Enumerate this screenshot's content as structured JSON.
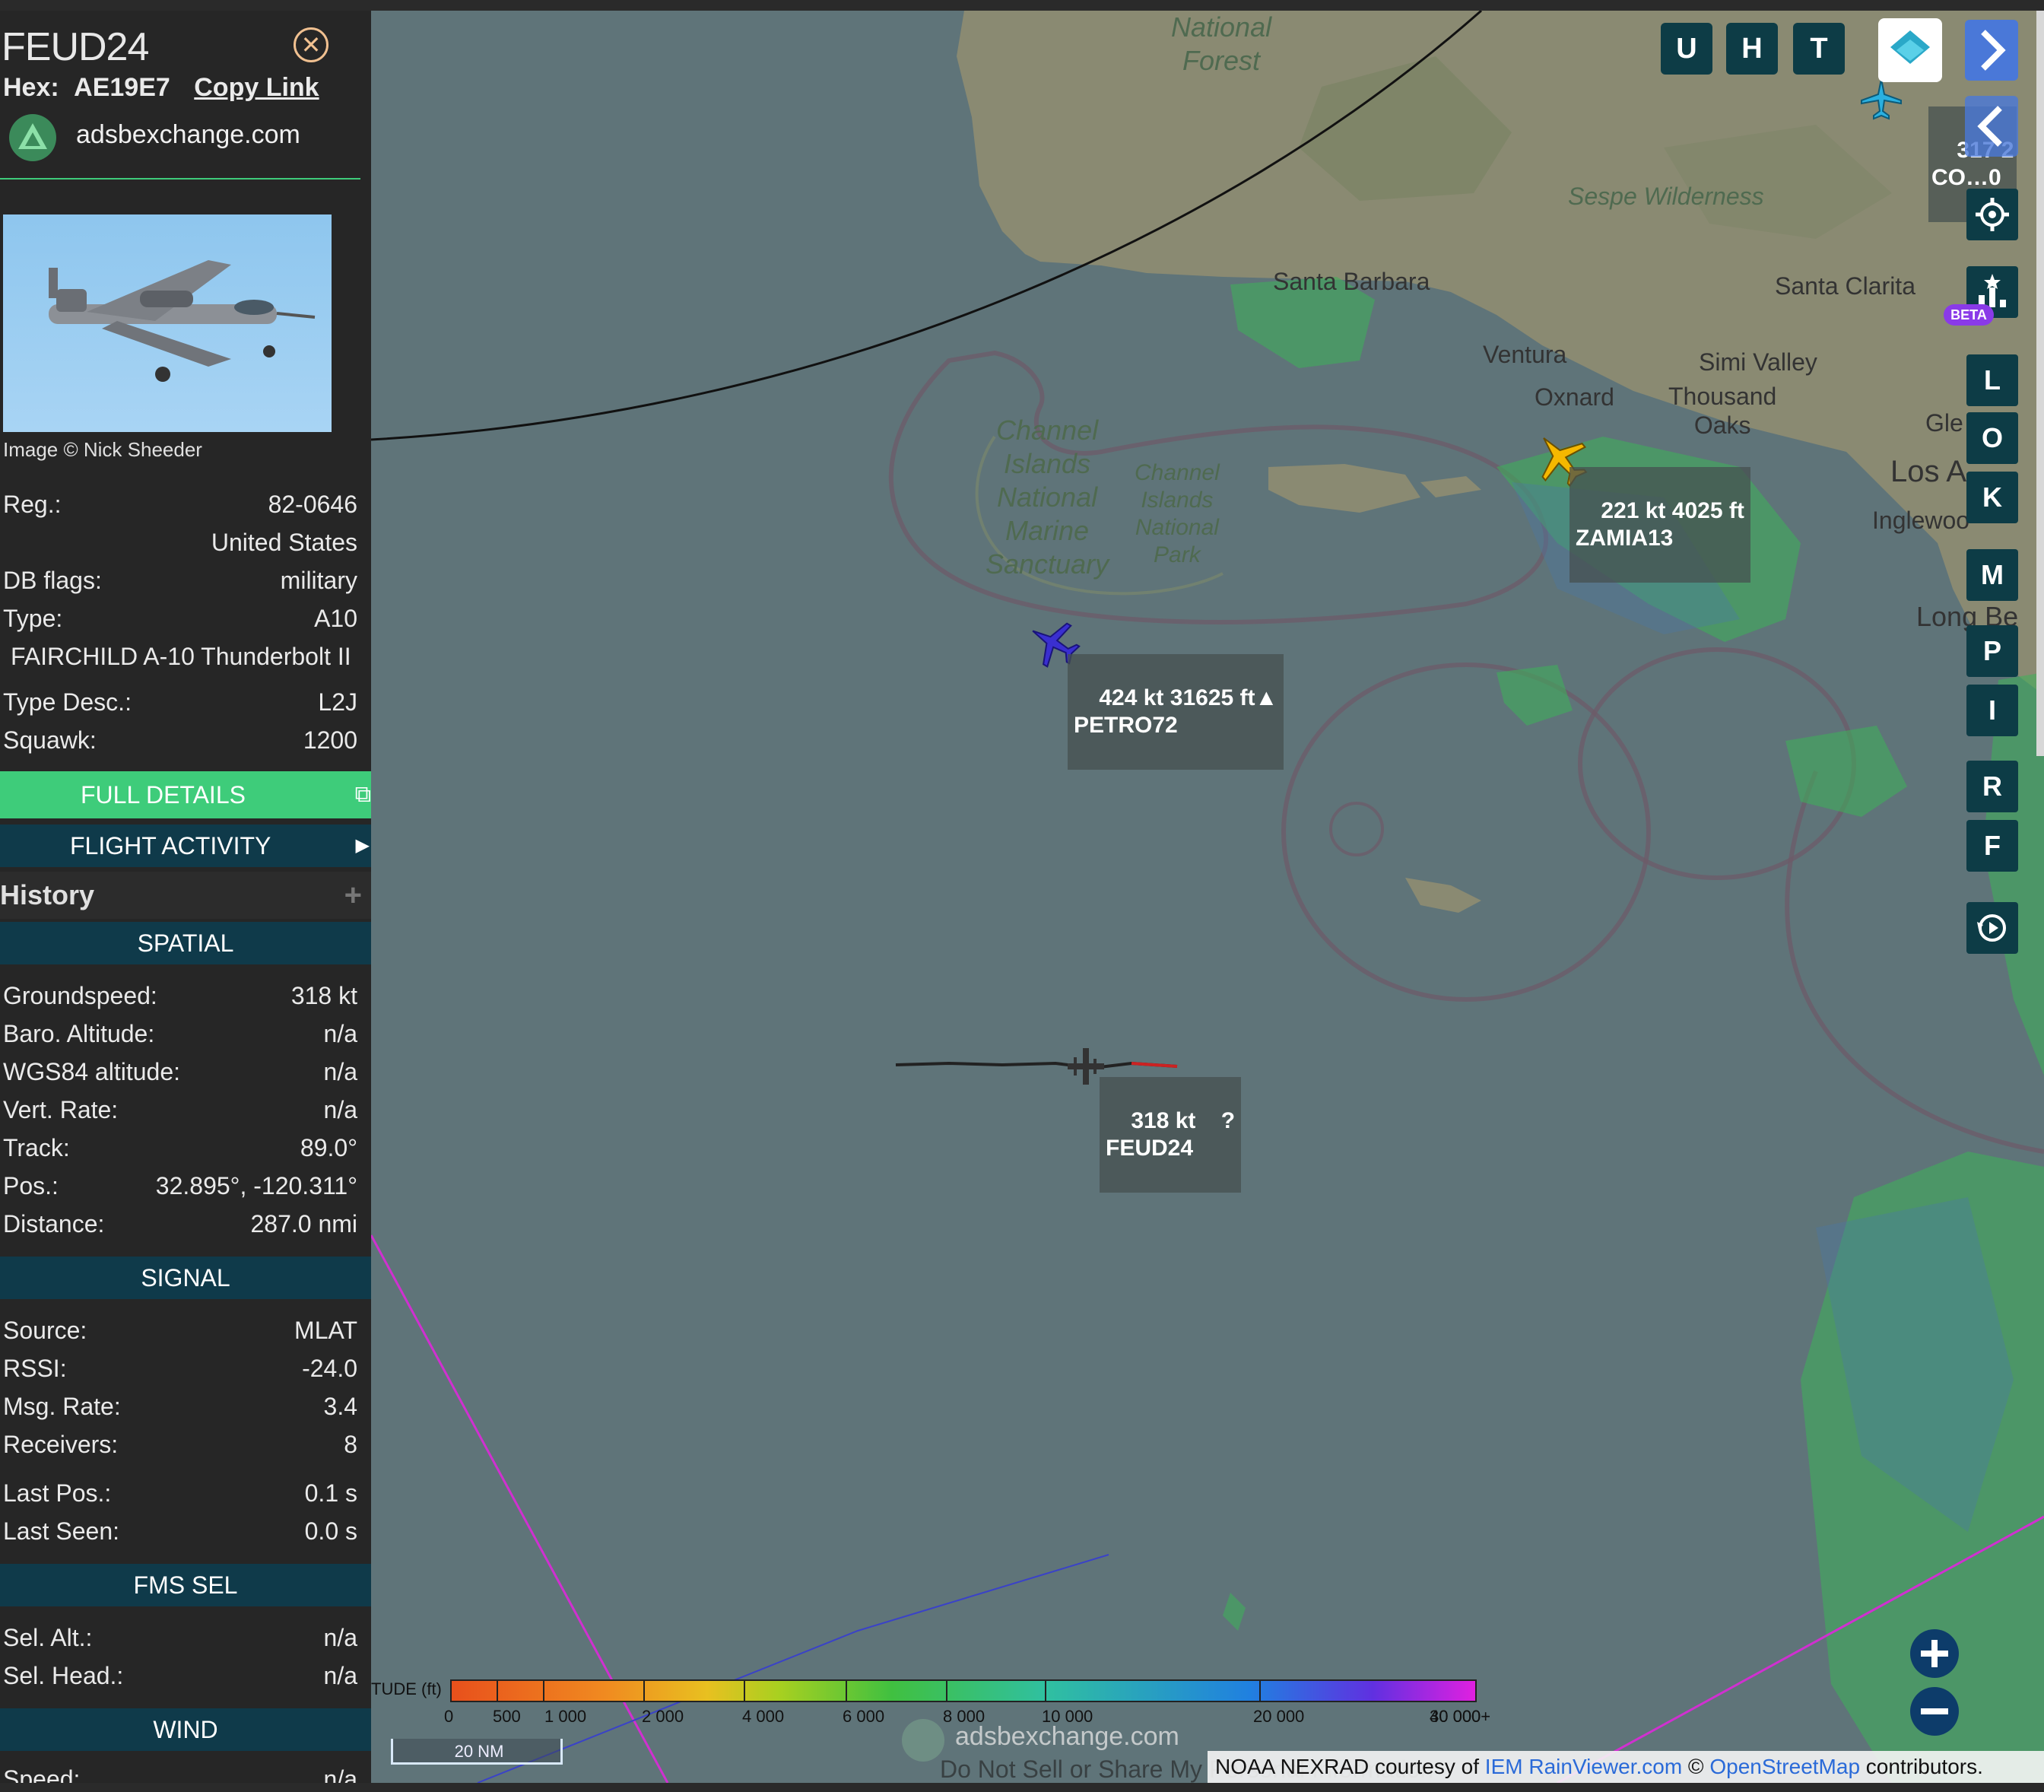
{
  "sidebar": {
    "callsign": "FEUD24",
    "hex_label": "Hex:",
    "hex_value": "AE19E7",
    "copy_link": "Copy Link",
    "site_name": "adsbexchange.com",
    "image_credit": "Image © Nick Sheeder",
    "fields_top": [
      {
        "label": "Reg.:",
        "value": "82-0646"
      },
      {
        "label": "",
        "value": "United States"
      },
      {
        "label": "DB flags:",
        "value": "military"
      },
      {
        "label": "Type:",
        "value": "A10"
      }
    ],
    "type_full": "FAIRCHILD A-10 Thunderbolt II",
    "fields_mid": [
      {
        "label": "Type Desc.:",
        "value": "L2J"
      },
      {
        "label": "Squawk:",
        "value": "1200"
      }
    ],
    "full_details": "FULL DETAILS",
    "flight_activity": "FLIGHT ACTIVITY",
    "history": "History",
    "spatial": "SPATIAL",
    "spatial_fields": [
      {
        "label": "Groundspeed:",
        "value": "318 kt"
      },
      {
        "label": "Baro. Altitude:",
        "value": "n/a"
      },
      {
        "label": "WGS84 altitude:",
        "value": "n/a"
      },
      {
        "label": "Vert. Rate:",
        "value": "n/a"
      },
      {
        "label": "Track:",
        "value": "89.0°"
      },
      {
        "label": "Pos.:",
        "value": "32.895°, -120.311°"
      },
      {
        "label": "Distance:",
        "value": "287.0 nmi"
      }
    ],
    "signal": "SIGNAL",
    "signal_fields": [
      {
        "label": "Source:",
        "value": "MLAT"
      },
      {
        "label": "RSSI:",
        "value": "-24.0"
      },
      {
        "label": "Msg. Rate:",
        "value": "3.4"
      },
      {
        "label": "Receivers:",
        "value": "8"
      }
    ],
    "seen_fields": [
      {
        "label": "Last Pos.:",
        "value": "0.1 s"
      },
      {
        "label": "Last Seen:",
        "value": "0.0 s"
      }
    ],
    "fms_sel": "FMS SEL",
    "fms_fields": [
      {
        "label": "Sel. Alt.:",
        "value": "n/a"
      },
      {
        "label": "Sel. Head.:",
        "value": "n/a"
      }
    ],
    "wind": "WIND",
    "wind_partial": "Speed:",
    "wind_partial_val": "n/a"
  },
  "map": {
    "place_labels": {
      "national_forest": "National\nForest",
      "sespe": "Sespe Wilderness",
      "santa_barbara": "Santa Barbara",
      "santa_clarita": "Santa Clarita",
      "ventura": "Ventura",
      "simi_valley": "Simi Valley",
      "oxnard": "Oxnard",
      "thousand_oaks": "Thousand\nOaks",
      "los_angeles": "Los A",
      "glendale": "Gle",
      "inglewood": "Inglewoo",
      "long_beach": "Long Be",
      "cinms": "Channel\nIslands\nNational\nMarine\nSanctuary",
      "cinp": "Channel\nIslands\nNational\nPark"
    },
    "aircraft": [
      {
        "name": "zamia",
        "speed": "221 kt",
        "alt": "4025 ft",
        "callsign": "ZAMIA13",
        "color": "#f5b800"
      },
      {
        "name": "petro",
        "speed": "424 kt",
        "alt": "31625 ft▲",
        "callsign": "PETRO72",
        "color": "#3a2fd0"
      },
      {
        "name": "feud",
        "speed": "318 kt",
        "alt": "?",
        "callsign": "FEUD24",
        "color": "#333333"
      },
      {
        "name": "corner",
        "speed": "317",
        "alt": "2",
        "callsign": "CO…0",
        "color": "#2ab0e0"
      }
    ],
    "top_buttons": [
      "U",
      "H",
      "T"
    ],
    "side_buttons": [
      "L",
      "O",
      "K",
      "M",
      "P",
      "I",
      "R",
      "F"
    ],
    "beta_badge": "BETA",
    "altitude_legend": {
      "title": "TUDE (ft)",
      "ticks": [
        "0",
        "500",
        "1 000",
        "2 000",
        "4 000",
        "6 000",
        "8 000",
        "10 000",
        "20 000",
        "30 000",
        "40 000+"
      ]
    },
    "scale": "20 NM",
    "watermark": "adsbexchange.com",
    "do_not_sell": "Do Not Sell or Share My Personal Information",
    "attribution": {
      "pre": "NOAA NEXRAD courtesy of ",
      "link1": "IEM RainViewer.com",
      "mid": " © ",
      "link2": "OpenStreetMap",
      "post": " contributors."
    }
  },
  "colors": {
    "ocean": "#5f7479",
    "land": "#8a8a72",
    "accent_green": "#3ecc7a",
    "section_teal": "#0f3a4a",
    "button_teal": "#0d3c46"
  }
}
